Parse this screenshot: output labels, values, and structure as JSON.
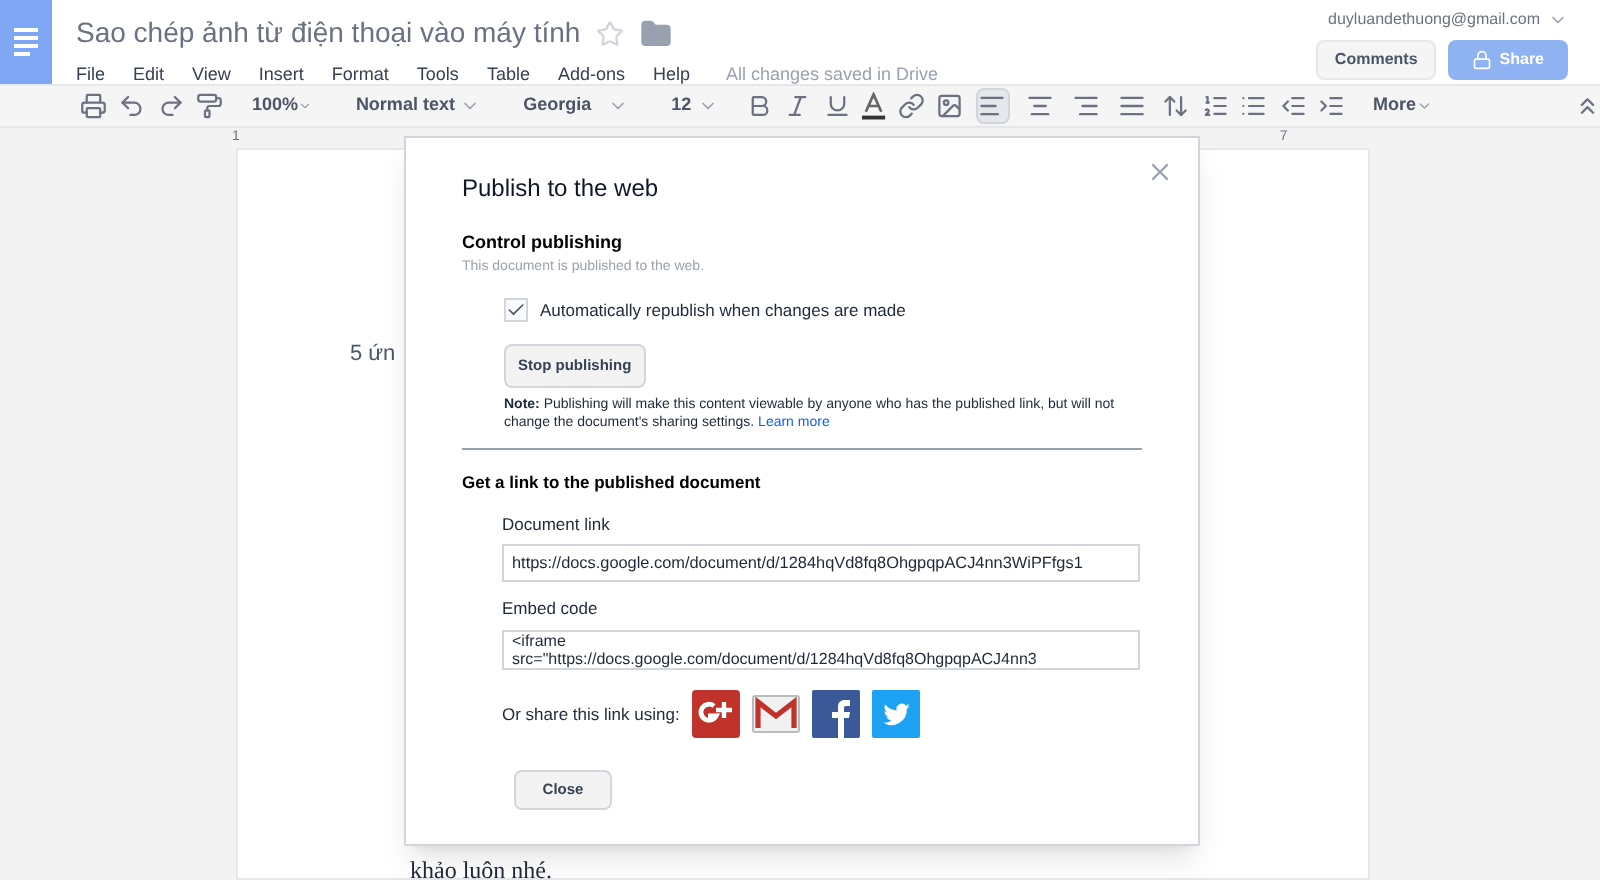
{
  "app": {
    "title": "Sao chép ảnh từ điện thoại vào máy tính",
    "account": "duyluandethuong@gmail.com",
    "starred": false,
    "save_status": "All changes saved in Drive"
  },
  "menu": [
    "File",
    "Edit",
    "View",
    "Insert",
    "Format",
    "Tools",
    "Table",
    "Add-ons",
    "Help"
  ],
  "header_buttons": {
    "comments": "Comments",
    "share": "Share"
  },
  "toolbar": {
    "zoom": "100%",
    "style": "Normal text",
    "font": "Georgia",
    "size": "12",
    "more": "More",
    "alignments": [
      {
        "selected": true
      },
      {
        "selected": false
      },
      {
        "selected": false
      },
      {
        "selected": false
      }
    ]
  },
  "ruler": [
    "1",
    "7"
  ],
  "document": {
    "texts": [
      "5 ứn",
      "khảo luôn nhé."
    ]
  },
  "dialog": {
    "title": "Publish to the web",
    "control_heading": "Control publishing",
    "control_status": "This document is published to the web.",
    "auto_republish": {
      "label": "Automatically republish when changes are made",
      "checked": true
    },
    "stop_button": "Stop publishing",
    "note": "**Note:** Publishing will make this content viewable by anyone who has the published link, but will not change the document's sharing settings.",
    "learn_more": "Learn more",
    "link_heading": "Get a link to the published document",
    "document_link": {
      "label": "Document link",
      "value": "https://docs.google.com/document/d/1284hqVd8fq8OhgpqpACJ4nn3WiPFfgs1"
    },
    "embed_code": {
      "label": "Embed code",
      "value": "<iframe\nsrc=\"https://docs.google.com/document/d/1284hqVd8fq8OhgpqpACJ4nn3"
    },
    "share_label": "Or share this link using:",
    "share_services": [
      {
        "kind": "gplus"
      },
      {
        "kind": "gmail"
      },
      {
        "kind": "facebook"
      },
      {
        "kind": "twitter"
      }
    ],
    "close_button": "Close"
  }
}
